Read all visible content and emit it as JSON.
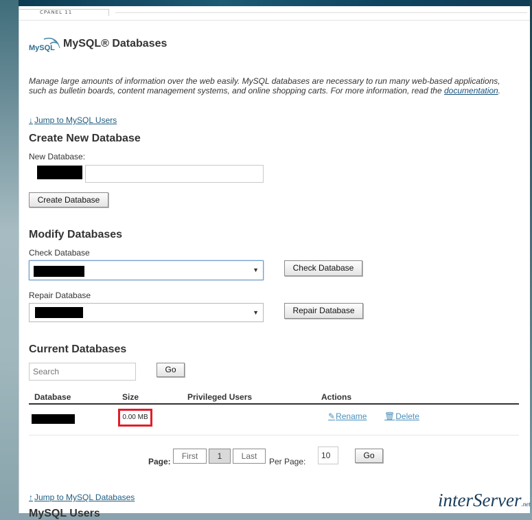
{
  "header": {
    "cpanel_tab": "CPANEL 11",
    "logo_text": "MySQL",
    "title": "MySQL® Databases"
  },
  "intro": {
    "text": "Manage large amounts of information over the web easily. MySQL databases are necessary to run many web-based applications, such as bulletin boards, content management systems, and online shopping carts. For more information, read the ",
    "link": "documentation",
    "tail": "."
  },
  "jump_users": {
    "arrow": "↓",
    "label": "Jump to MySQL Users"
  },
  "create": {
    "heading": "Create New Database",
    "new_db_label": "New Database:",
    "new_db_value": "",
    "create_button": "Create Database"
  },
  "modify": {
    "heading": "Modify Databases",
    "check_label": "Check Database",
    "check_button": "Check Database",
    "repair_label": "Repair Database",
    "repair_button": "Repair Database"
  },
  "current": {
    "heading": "Current Databases",
    "search_placeholder": "Search",
    "go_button": "Go",
    "columns": [
      "Database",
      "Size",
      "Privileged Users",
      "Actions"
    ],
    "rows": [
      {
        "size": "0.00 MB",
        "privileged_users": "",
        "rename": "Rename",
        "delete": "Delete"
      }
    ]
  },
  "pagination": {
    "page_label": "Page:",
    "first": "First",
    "current_page": "1",
    "last": "Last",
    "per_page_label": "Per Page:",
    "per_page_value": "10",
    "go_button": "Go"
  },
  "jump_databases": {
    "arrow": "↑",
    "label": "Jump to MySQL Databases"
  },
  "next_section_heading": "MySQL Users",
  "brand": {
    "name": "interServer",
    "suffix": ".net"
  },
  "colors": {
    "accent": "#1f5c80",
    "highlight_border": "#e11d2a",
    "link": "#4a8fbd"
  }
}
